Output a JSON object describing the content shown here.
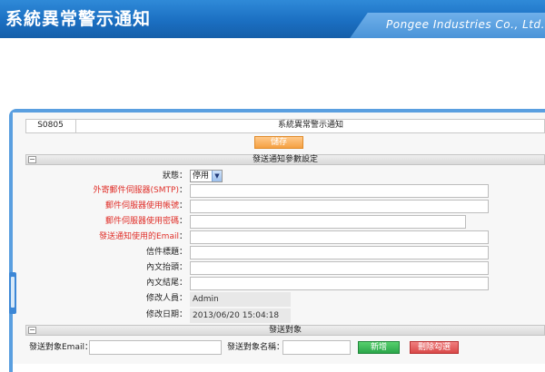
{
  "banner": {
    "title": "系統異常警示通知",
    "company": "Pongee Industries Co., Ltd."
  },
  "program": {
    "id": "S0805",
    "title": "系統異常警示通知",
    "save_label": "儲存"
  },
  "sections": {
    "params": {
      "title": "發送通知參數設定",
      "collapse_icon": "minus-icon"
    },
    "targets": {
      "title": "發送對象",
      "collapse_icon": "minus-icon"
    }
  },
  "form": {
    "status": {
      "label": "狀態",
      "value": "停用"
    },
    "smtp": {
      "label": "外寄郵件伺服器(SMTP)",
      "value": ""
    },
    "account": {
      "label": "郵件伺服器使用帳號",
      "value": ""
    },
    "password": {
      "label": "郵件伺服器使用密碼",
      "value": ""
    },
    "sender_email": {
      "label": "發送通知使用的Email",
      "value": ""
    },
    "subject": {
      "label": "信件標題",
      "value": ""
    },
    "header_text": {
      "label": "內文抬頭",
      "value": ""
    },
    "footer_text": {
      "label": "內文結尾",
      "value": ""
    },
    "modified_by": {
      "label": "修改人員",
      "value": "Admin"
    },
    "modified_date": {
      "label": "修改日期",
      "value": "2013/06/20 15:04:18"
    },
    "colon": "："
  },
  "targets": {
    "email_label": "發送對象Email：",
    "email_value": "",
    "name_label": "發送對象名稱：",
    "name_value": "",
    "add_label": "新增",
    "remove_label": "刪除勾選"
  },
  "colors": {
    "banner": "#1b6fc2",
    "required_label": "#e0302a",
    "save_button": "#f5a042",
    "add_button": "#2ba64a",
    "remove_button": "#d94848"
  }
}
